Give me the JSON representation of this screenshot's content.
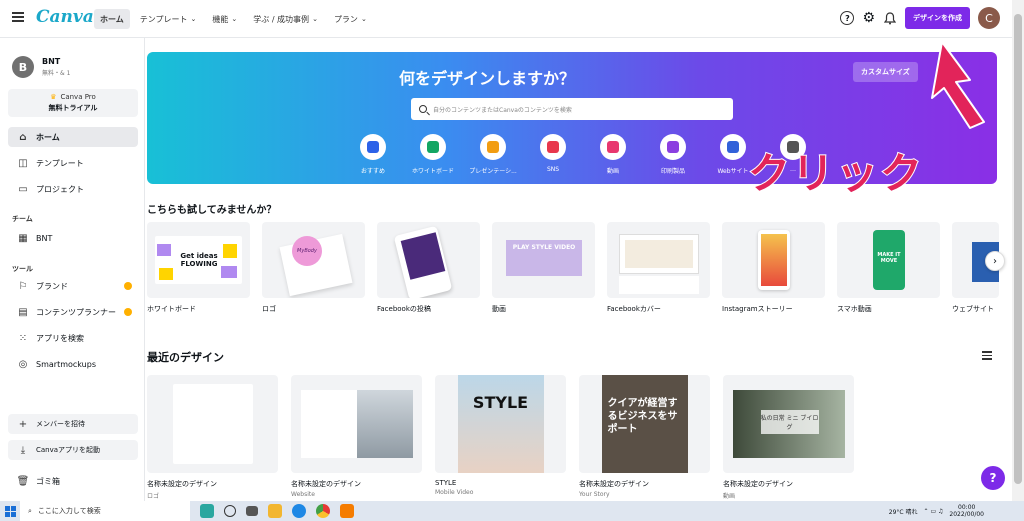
{
  "topnav": {
    "logo": "Canva",
    "menu": [
      {
        "label": "ホーム",
        "active": true,
        "chevron": false
      },
      {
        "label": "テンプレート",
        "active": false,
        "chevron": true
      },
      {
        "label": "機能",
        "active": false,
        "chevron": true
      },
      {
        "label": "学ぶ / 成功事例",
        "active": false,
        "chevron": true
      },
      {
        "label": "プラン",
        "active": false,
        "chevron": true
      }
    ],
    "help_icon": "?",
    "create_button": "デザインを作成",
    "avatar_letter": "C"
  },
  "sidebar": {
    "user": {
      "initial": "B",
      "name": "BNT",
      "sub": "無料・& 1"
    },
    "trial": {
      "line1": "Canva Pro",
      "line2": "無料トライアル"
    },
    "items": [
      {
        "label": "ホーム",
        "icon": "home-icon"
      },
      {
        "label": "テンプレート",
        "icon": "template-icon"
      },
      {
        "label": "プロジェクト",
        "icon": "folder-icon"
      }
    ],
    "team_section": "チーム",
    "team_item": "BNT",
    "tools_section": "ツール",
    "tools": [
      {
        "label": "ブランド",
        "badge": true
      },
      {
        "label": "コンテンツプランナー",
        "badge": true
      },
      {
        "label": "アプリを検索",
        "badge": false
      },
      {
        "label": "Smartmockups",
        "badge": false
      }
    ],
    "invite_button": "メンバーを招待",
    "download_button": "Canvaアプリを起動",
    "trash": "ゴミ箱"
  },
  "banner": {
    "title": "何をデザインしますか？",
    "custom_size": "カスタムサイズ",
    "search_placeholder": "自分のコンテンツまたはCanvaのコンテンツを検索",
    "categories": [
      {
        "label": "おすすめ",
        "color": "#2c62e8"
      },
      {
        "label": "ホワイトボード",
        "color": "#13a663"
      },
      {
        "label": "プレゼンテーシ...",
        "color": "#f29d12"
      },
      {
        "label": "SNS",
        "color": "#e8374d"
      },
      {
        "label": "動画",
        "color": "#e8376f"
      },
      {
        "label": "印刷製品",
        "color": "#8b3fe0"
      },
      {
        "label": "Webサイト",
        "color": "#3261d9"
      },
      {
        "label": "…",
        "color": "#555555"
      }
    ]
  },
  "try_section": {
    "heading": "こちらも試してみませんか？",
    "cards": [
      {
        "label": "ホワイトボード",
        "thumb_text": "Get ideas FLOWING"
      },
      {
        "label": "ロゴ",
        "thumb_text": "MyBody"
      },
      {
        "label": "Facebookの投稿",
        "thumb_text": ""
      },
      {
        "label": "動画",
        "thumb_text": "PLAY STYLE VIDEO"
      },
      {
        "label": "Facebookカバー",
        "thumb_text": ""
      },
      {
        "label": "Instagramストーリー",
        "thumb_text": ""
      },
      {
        "label": "スマホ動画",
        "thumb_text": "MAKE IT MOVE"
      },
      {
        "label": "ウェブサイト",
        "thumb_text": ""
      }
    ]
  },
  "recent_section": {
    "heading": "最近のデザイン",
    "cards": [
      {
        "title": "名称未設定のデザイン",
        "sub": "ロゴ",
        "thumb_text": ""
      },
      {
        "title": "名称未設定のデザイン",
        "sub": "Website",
        "thumb_text": ""
      },
      {
        "title": "STYLE",
        "sub": "Mobile Video",
        "thumb_text": "STYLE"
      },
      {
        "title": "名称未設定のデザイン",
        "sub": "Your Story",
        "thumb_text": "クイアが経営するビジネスをサポート"
      },
      {
        "title": "名称未設定のデザイン",
        "sub": "動画",
        "thumb_text": "私の日常 ミニ ブイログ"
      }
    ]
  },
  "help_button": "?",
  "annotation": {
    "click_text": "クリック",
    "color": "#e2245a"
  },
  "taskbar": {
    "search_placeholder": "ここに入力して検索",
    "weather": "29°C 晴れ",
    "time": "00:00",
    "date": "2022/00/00"
  }
}
